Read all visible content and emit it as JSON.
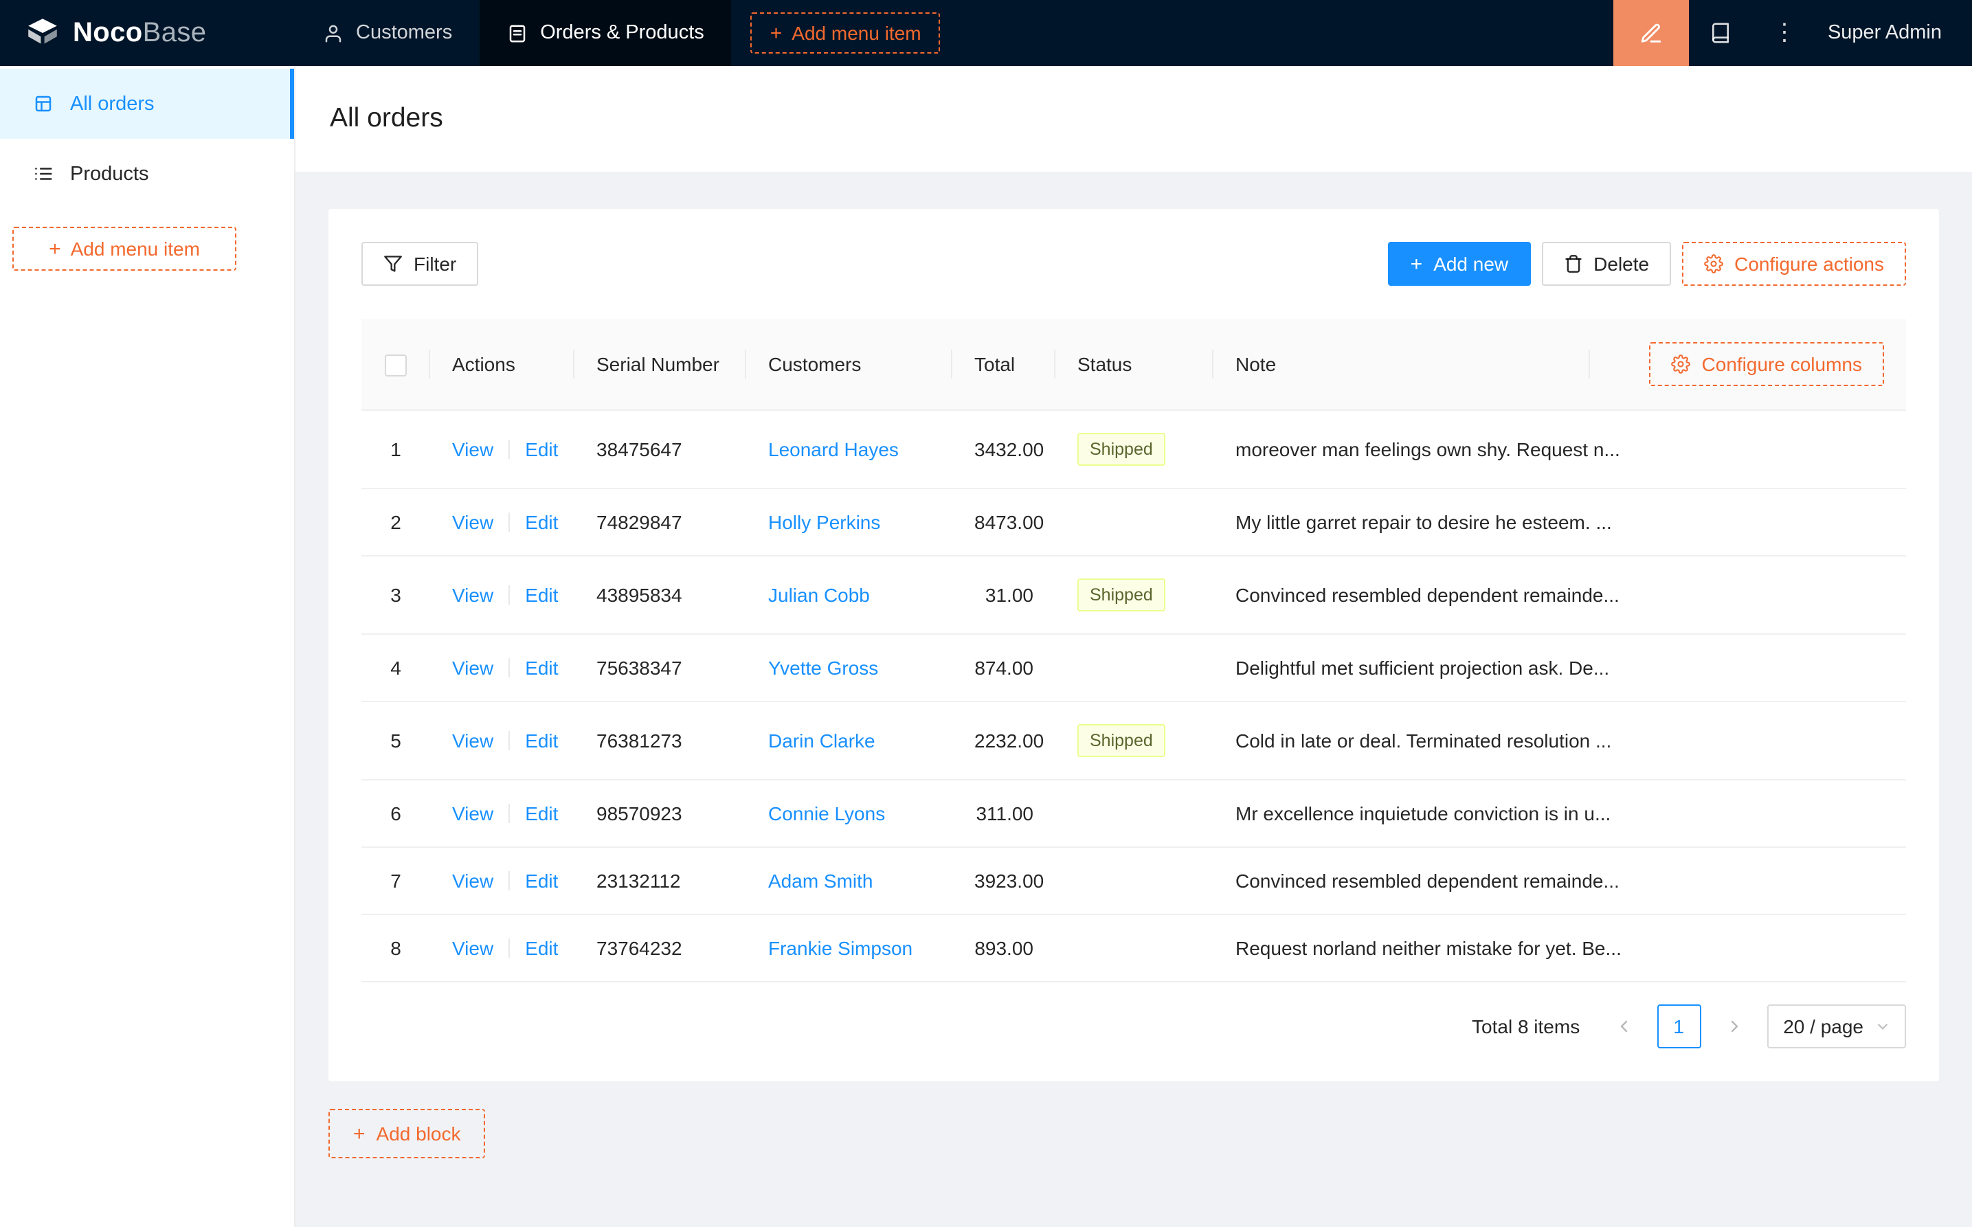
{
  "navbar": {
    "logo_primary": "Noco",
    "logo_secondary": "Base",
    "items": [
      {
        "label": "Customers"
      },
      {
        "label": "Orders & Products"
      }
    ],
    "add_menu_item_label": "Add menu item",
    "user": "Super Admin"
  },
  "sidebar": {
    "items": [
      {
        "label": "All orders"
      },
      {
        "label": "Products"
      }
    ],
    "add_menu_item_label": "Add menu item"
  },
  "page": {
    "title": "All orders"
  },
  "toolbar": {
    "filter": "Filter",
    "add_new": "Add new",
    "delete": "Delete",
    "configure_actions": "Configure actions"
  },
  "table": {
    "headers": {
      "actions": "Actions",
      "serial_number": "Serial Number",
      "customers": "Customers",
      "total": "Total",
      "status": "Status",
      "note": "Note"
    },
    "configure_columns": "Configure columns",
    "view_label": "View",
    "edit_label": "Edit",
    "rows": [
      {
        "index": "1",
        "serial": "38475647",
        "customer": "Leonard Hayes",
        "total": "3432.00",
        "status": "Shipped",
        "note": "moreover man feelings own shy. Request n..."
      },
      {
        "index": "2",
        "serial": "74829847",
        "customer": "Holly Perkins",
        "total": "8473.00",
        "status": "",
        "note": "My little garret repair to desire he esteem. ..."
      },
      {
        "index": "3",
        "serial": "43895834",
        "customer": "Julian Cobb",
        "total": "31.00",
        "status": "Shipped",
        "note": "Convinced resembled dependent remainde..."
      },
      {
        "index": "4",
        "serial": "75638347",
        "customer": "Yvette Gross",
        "total": "874.00",
        "status": "",
        "note": "Delightful met sufficient projection ask. De..."
      },
      {
        "index": "5",
        "serial": "76381273",
        "customer": "Darin Clarke",
        "total": "2232.00",
        "status": "Shipped",
        "note": "Cold in late or deal. Terminated resolution ..."
      },
      {
        "index": "6",
        "serial": "98570923",
        "customer": "Connie Lyons",
        "total": "311.00",
        "status": "",
        "note": "Mr excellence inquietude conviction is in u..."
      },
      {
        "index": "7",
        "serial": "23132112",
        "customer": "Adam Smith",
        "total": "3923.00",
        "status": "",
        "note": "Convinced resembled dependent remainde..."
      },
      {
        "index": "8",
        "serial": "73764232",
        "customer": "Frankie Simpson",
        "total": "893.00",
        "status": "",
        "note": "Request norland neither mistake for yet. Be..."
      }
    ]
  },
  "pagination": {
    "total_text": "Total 8 items",
    "current_page": "1",
    "page_size": "20 / page"
  },
  "footer": {
    "add_block": "Add block"
  },
  "icons": {
    "plus": "+",
    "more_vertical": "⋮"
  },
  "colors": {
    "navbar_bg": "#001529",
    "accent_orange": "#f3692e",
    "designer_button_orange": "#f18b62",
    "primary_blue": "#1890ff",
    "shipped_tag_bg": "#fcffe6",
    "shipped_tag_border": "#eaff8f",
    "active_menu_bg": "#e6f7ff"
  }
}
